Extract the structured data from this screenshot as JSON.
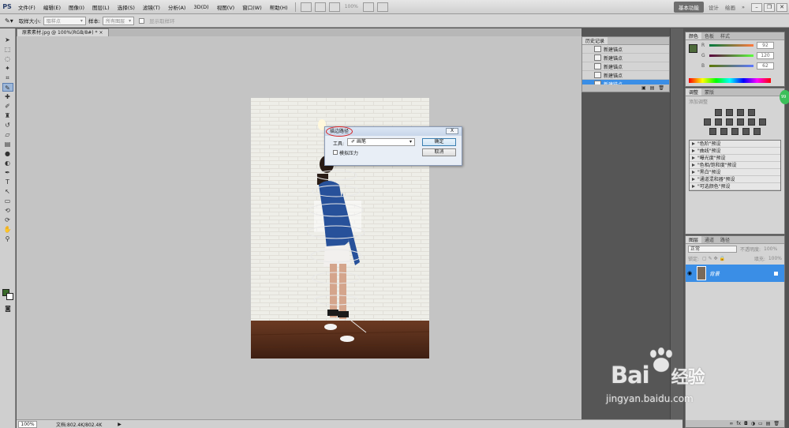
{
  "app": {
    "logo": "PS",
    "menus": [
      "文件(F)",
      "编辑(E)",
      "图像(I)",
      "图层(L)",
      "选择(S)",
      "滤镜(T)",
      "分析(A)",
      "3D(D)",
      "视图(V)",
      "窗口(W)",
      "帮助(H)"
    ],
    "zoom_level": "100%",
    "workspace_active": "基本功能",
    "workspace_items": [
      "设计",
      "绘画"
    ]
  },
  "options_bar": {
    "sample_size_label": "取样大小:",
    "sample_size_value": "取样点",
    "sample_label": "样本:",
    "sample_value": "所有图层",
    "show_ring_label": "显示取样环"
  },
  "document": {
    "tab_title": "原素素材.jpg @ 100%(RGB/8#) *",
    "status_zoom": "100%",
    "status_doc": "文档:802.4K/802.4K"
  },
  "history": {
    "tabs": [
      "历史记录"
    ],
    "items": [
      "新建锚点",
      "新建锚点",
      "新建锚点",
      "新建锚点",
      "新建锚点"
    ],
    "active_index": 4
  },
  "color_panel": {
    "tabs": [
      "颜色",
      "色板",
      "样式"
    ],
    "r_label": "R",
    "r_value": "92",
    "g_label": "G",
    "g_value": "120",
    "b_label": "B",
    "b_value": "62"
  },
  "adjustments": {
    "tabs": [
      "调整",
      "蒙版"
    ],
    "title": "添加调整",
    "presets": [
      "\"色阶\"预设",
      "\"曲线\"预设",
      "\"曝光度\"预设",
      "\"色相/饱和度\"预设",
      "\"黑白\"预设",
      "\"通道混和器\"预设",
      "\"可选颜色\"预设"
    ]
  },
  "layers": {
    "tabs": [
      "图层",
      "通道",
      "路径"
    ],
    "mode": "正常",
    "opacity_label": "不透明度:",
    "opacity_value": "100%",
    "lock_label": "锁定:",
    "fill_label": "填充:",
    "fill_value": "100%",
    "layer_name": "背景"
  },
  "dialog": {
    "title": "描边路径",
    "close_label": "X",
    "tool_label": "工具:",
    "tool_value": "画笔",
    "simulate_pressure_label": "模拟压力",
    "ok_label": "确定",
    "cancel_label": "取消"
  },
  "watermark": {
    "brand": "Bai",
    "brand2": "经验",
    "url": "jingyan.baidu.com"
  },
  "badge": {
    "label": "99"
  },
  "colors": {
    "selection_blue": "#3a8ee6",
    "dialog_highlight_ring": "#d82020",
    "foreground": "#4d6a3a"
  }
}
